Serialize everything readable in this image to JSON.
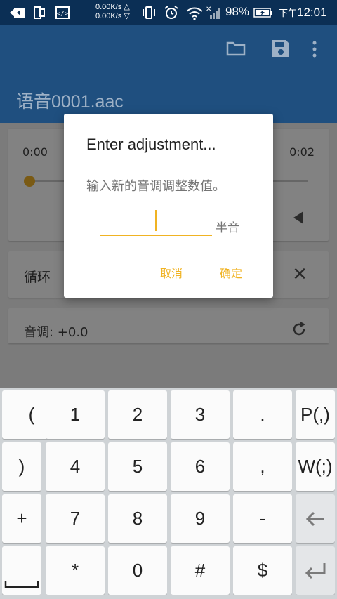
{
  "status_bar": {
    "net_speed_up": "0.00K/s",
    "net_speed_down": "0.00K/s",
    "battery": "98%",
    "time_prefix": "下午",
    "time": "12:01",
    "icons": [
      "usb-debug-icon",
      "phone-icon",
      "code-icon",
      "vibrate-icon",
      "alarm-icon",
      "wifi-icon",
      "signal-icon",
      "battery-charging-icon"
    ]
  },
  "app_bar": {
    "title": "语音0001.aac",
    "actions": [
      "folder-icon",
      "save-icon",
      "more-vert-icon"
    ],
    "color": "#1f4f7f"
  },
  "player": {
    "time_start": "0:00",
    "time_end": "0:02",
    "position": 0.0
  },
  "loop": {
    "label": "循环"
  },
  "pitch": {
    "label": "音调: +0.0"
  },
  "dialog": {
    "title": "Enter adjustment...",
    "message": "输入新的音调调整数值。",
    "input_value": "",
    "unit": "半音",
    "cancel": "取消",
    "ok": "确定",
    "accent": "#f0b323"
  },
  "keyboard": {
    "rows": [
      [
        "(",
        "1",
        "2",
        "3",
        ".",
        "P(,)"
      ],
      [
        ")",
        "4",
        "5",
        "6",
        ",",
        "W(;)"
      ],
      [
        "+",
        "7",
        "8",
        "9",
        "-",
        "backspace-icon"
      ],
      [
        "space-icon",
        "*",
        "0",
        "#",
        "$",
        "enter-icon"
      ]
    ]
  }
}
